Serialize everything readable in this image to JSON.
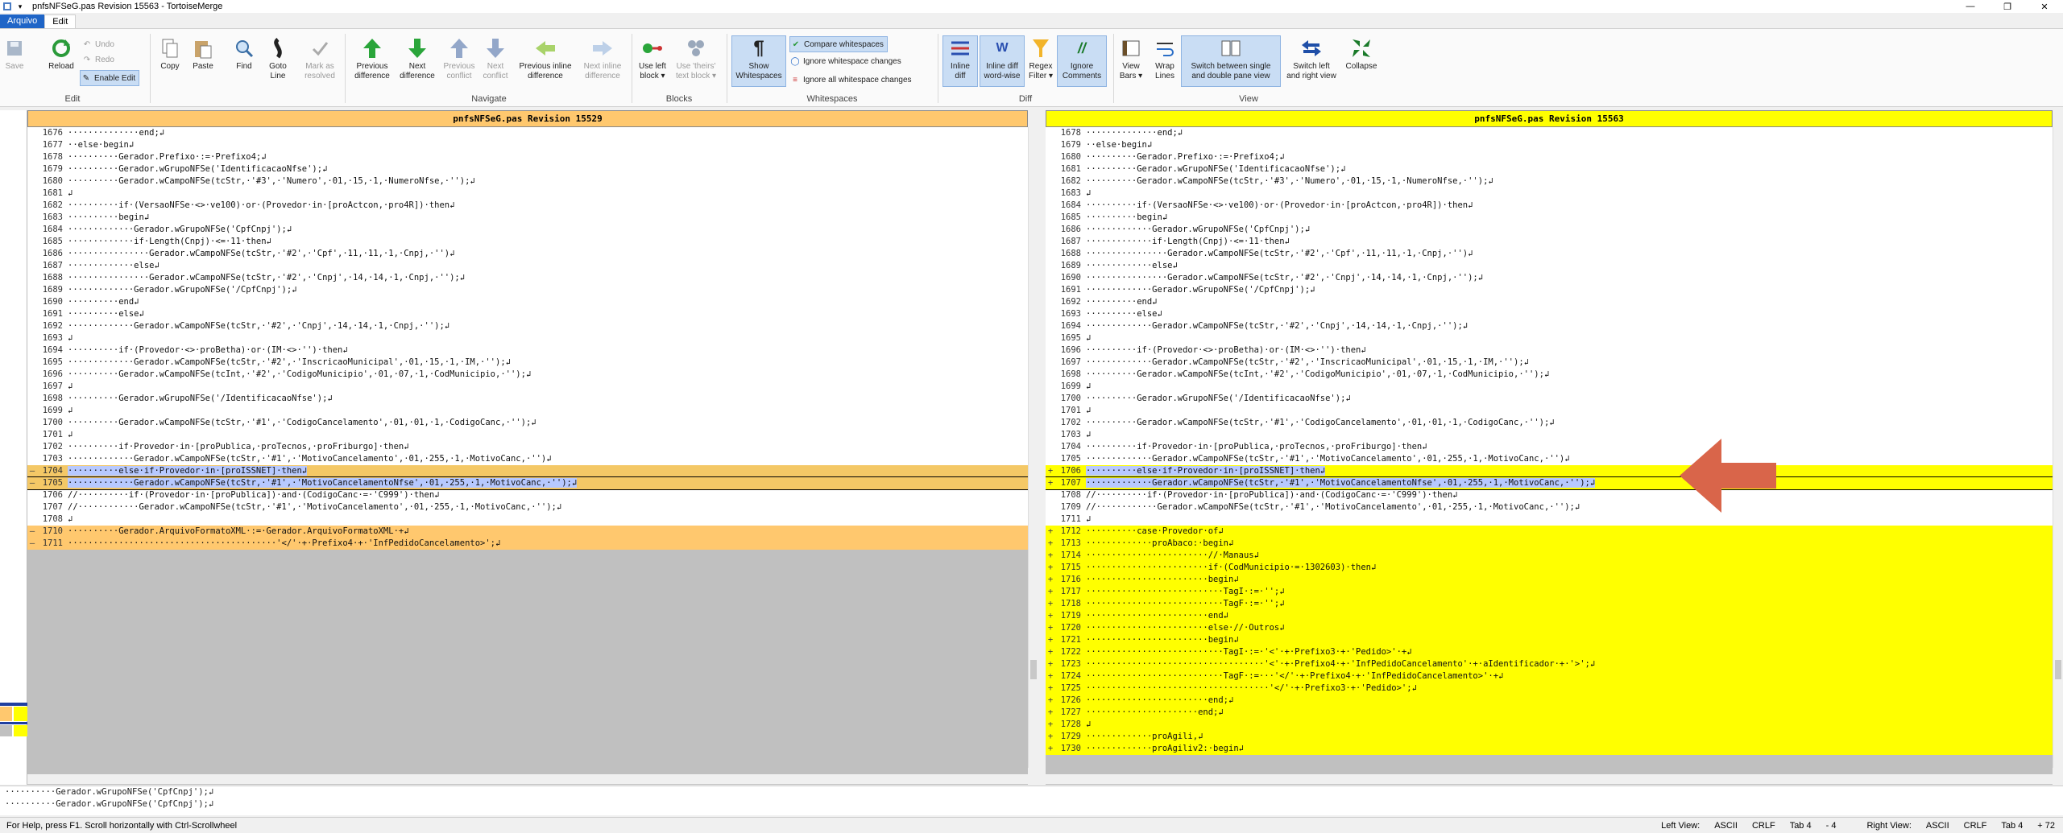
{
  "window": {
    "title": "pnfsNFSeG.pas Revision 15563 - TortoiseMerge"
  },
  "tabs": {
    "file": "Arquivo",
    "edit": "Edit"
  },
  "ribbon": {
    "save": "Save",
    "reload": "Reload",
    "undo": "Undo",
    "redo": "Redo",
    "enable_edit": "Enable Edit",
    "copy": "Copy",
    "paste": "Paste",
    "find": "Find",
    "goto": "Goto\nLine",
    "mark_resolved": "Mark as\nresolved",
    "prev_diff": "Previous\ndifference",
    "next_diff": "Next\ndifference",
    "prev_conflict": "Previous\nconflict",
    "next_conflict": "Next\nconflict",
    "prev_inline": "Previous inline\ndifference",
    "next_inline": "Next inline\ndifference",
    "use_left": "Use left\nblock ▾",
    "use_theirs": "Use 'theirs'\ntext block ▾",
    "show_ws": "Show\nWhitespaces",
    "compare_ws": "Compare whitespaces",
    "ignore_ws_changes": "Ignore whitespace changes",
    "ignore_all_ws": "Ignore all whitespace changes",
    "inline_diff": "Inline\ndiff",
    "inline_diff_word": "Inline diff\nword-wise",
    "regex_filter": "Regex\nFilter ▾",
    "ignore_comments": "Ignore\nComments",
    "view_bars": "View\nBars ▾",
    "wrap_lines": "Wrap\nLines",
    "switch_single_double": "Switch between single\nand double pane view",
    "switch_lr": "Switch left\nand right view",
    "collapse": "Collapse",
    "groups": {
      "edit": "Edit",
      "navigate": "Navigate",
      "blocks": "Blocks",
      "whitespaces": "Whitespaces",
      "diff": "Diff",
      "view": "View"
    }
  },
  "left": {
    "header": "pnfsNFSeG.pas Revision 15529",
    "lines": [
      {
        "m": "",
        "n": "1676",
        "t": "··············end;↲",
        "c": "nrm"
      },
      {
        "m": "",
        "n": "1677",
        "t": "··else·begin↲",
        "c": "nrm"
      },
      {
        "m": "",
        "n": "1678",
        "t": "··········Gerador.Prefixo·:=·Prefixo4;↲",
        "c": "nrm"
      },
      {
        "m": "",
        "n": "1679",
        "t": "··········Gerador.wGrupoNFSe('IdentificacaoNfse');↲",
        "c": "nrm"
      },
      {
        "m": "",
        "n": "1680",
        "t": "··········Gerador.wCampoNFSe(tcStr,·'#3',·'Numero',·01,·15,·1,·NumeroNfse,·'');↲",
        "c": "nrm"
      },
      {
        "m": "",
        "n": "1681",
        "t": "↲",
        "c": "nrm"
      },
      {
        "m": "",
        "n": "1682",
        "t": "··········if·(VersaoNFSe·<>·ve100)·or·(Provedor·in·[proActcon,·pro4R])·then↲",
        "c": "nrm"
      },
      {
        "m": "",
        "n": "1683",
        "t": "··········begin↲",
        "c": "nrm"
      },
      {
        "m": "",
        "n": "1684",
        "t": "·············Gerador.wGrupoNFSe('CpfCnpj');↲",
        "c": "nrm"
      },
      {
        "m": "",
        "n": "1685",
        "t": "·············if·Length(Cnpj)·<=·11·then↲",
        "c": "nrm"
      },
      {
        "m": "",
        "n": "1686",
        "t": "················Gerador.wCampoNFSe(tcStr,·'#2',·'Cpf',·11,·11,·1,·Cnpj,·'')↲",
        "c": "nrm"
      },
      {
        "m": "",
        "n": "1687",
        "t": "·············else↲",
        "c": "nrm"
      },
      {
        "m": "",
        "n": "1688",
        "t": "················Gerador.wCampoNFSe(tcStr,·'#2',·'Cnpj',·14,·14,·1,·Cnpj,·'');↲",
        "c": "nrm"
      },
      {
        "m": "",
        "n": "1689",
        "t": "·············Gerador.wGrupoNFSe('/CpfCnpj');↲",
        "c": "nrm"
      },
      {
        "m": "",
        "n": "1690",
        "t": "··········end↲",
        "c": "nrm"
      },
      {
        "m": "",
        "n": "1691",
        "t": "··········else↲",
        "c": "nrm"
      },
      {
        "m": "",
        "n": "1692",
        "t": "·············Gerador.wCampoNFSe(tcStr,·'#2',·'Cnpj',·14,·14,·1,·Cnpj,·'');↲",
        "c": "nrm"
      },
      {
        "m": "",
        "n": "1693",
        "t": "↲",
        "c": "nrm"
      },
      {
        "m": "",
        "n": "1694",
        "t": "··········if·(Provedor·<>·proBetha)·or·(IM·<>·'')·then↲",
        "c": "nrm"
      },
      {
        "m": "",
        "n": "1695",
        "t": "·············Gerador.wCampoNFSe(tcStr,·'#2',·'InscricaoMunicipal',·01,·15,·1,·IM,·'');↲",
        "c": "nrm"
      },
      {
        "m": "",
        "n": "1696",
        "t": "··········Gerador.wCampoNFSe(tcInt,·'#2',·'CodigoMunicipio',·01,·07,·1,·CodMunicipio,·'');↲",
        "c": "nrm"
      },
      {
        "m": "",
        "n": "1697",
        "t": "↲",
        "c": "nrm"
      },
      {
        "m": "",
        "n": "1698",
        "t": "··········Gerador.wGrupoNFSe('/IdentificacaoNfse');↲",
        "c": "nrm"
      },
      {
        "m": "",
        "n": "1699",
        "t": "↲",
        "c": "nrm"
      },
      {
        "m": "",
        "n": "1700",
        "t": "··········Gerador.wCampoNFSe(tcStr,·'#1',·'CodigoCancelamento',·01,·01,·1,·CodigoCanc,·'');↲",
        "c": "nrm"
      },
      {
        "m": "",
        "n": "1701",
        "t": "↲",
        "c": "nrm"
      },
      {
        "m": "",
        "n": "1702",
        "t": "··········if·Provedor·in·[proPublica,·proTecnos,·proFriburgo]·then↲",
        "c": "nrm"
      },
      {
        "m": "",
        "n": "1703",
        "t": "·············Gerador.wCampoNFSe(tcStr,·'#1',·'MotivoCancelamento',·01,·255,·1,·MotivoCanc,·'')↲",
        "c": "nrm"
      },
      {
        "m": "—",
        "n": "1704",
        "t": "··········else·if·Provedor·in·[proISSNET]·then↲",
        "c": "modl",
        "sel": true
      },
      {
        "m": "—",
        "n": "1705",
        "t": "·············Gerador.wCampoNFSe(tcStr,·'#1',·'MotivoCancelamentoNfse',·01,·255,·1,·MotivoCanc,·'');↲",
        "c": "modl",
        "sel": true,
        "box": true
      },
      {
        "m": "",
        "n": "1706",
        "t": "//··········if·(Provedor·in·[proPublica])·and·(CodigoCanc·=·'C999')·then↲",
        "c": "nrm"
      },
      {
        "m": "",
        "n": "1707",
        "t": "//············Gerador.wCampoNFSe(tcStr,·'#1',·'MotivoCancelamento',·01,·255,·1,·MotivoCanc,·'');↲",
        "c": "nrm"
      },
      {
        "m": "",
        "n": "1708",
        "t": "↲",
        "c": "nrm"
      },
      {
        "m": "—",
        "n": "1710",
        "t": "··········Gerador.ArquivoFormatoXML·:=·Gerador.ArquivoFormatoXML·+↲",
        "c": "rem"
      },
      {
        "m": "—",
        "n": "1711",
        "t": "·········································'</'·+·Prefixo4·+·'InfPedidoCancelamento>';↲",
        "c": "rem"
      }
    ]
  },
  "right": {
    "header": "pnfsNFSeG.pas Revision 15563",
    "lines": [
      {
        "m": "",
        "n": "1678",
        "t": "··············end;↲",
        "c": "nrm"
      },
      {
        "m": "",
        "n": "1679",
        "t": "··else·begin↲",
        "c": "nrm"
      },
      {
        "m": "",
        "n": "1680",
        "t": "··········Gerador.Prefixo·:=·Prefixo4;↲",
        "c": "nrm"
      },
      {
        "m": "",
        "n": "1681",
        "t": "··········Gerador.wGrupoNFSe('IdentificacaoNfse');↲",
        "c": "nrm"
      },
      {
        "m": "",
        "n": "1682",
        "t": "··········Gerador.wCampoNFSe(tcStr,·'#3',·'Numero',·01,·15,·1,·NumeroNfse,·'');↲",
        "c": "nrm"
      },
      {
        "m": "",
        "n": "1683",
        "t": "↲",
        "c": "nrm"
      },
      {
        "m": "",
        "n": "1684",
        "t": "··········if·(VersaoNFSe·<>·ve100)·or·(Provedor·in·[proActcon,·pro4R])·then↲",
        "c": "nrm"
      },
      {
        "m": "",
        "n": "1685",
        "t": "··········begin↲",
        "c": "nrm"
      },
      {
        "m": "",
        "n": "1686",
        "t": "·············Gerador.wGrupoNFSe('CpfCnpj');↲",
        "c": "nrm"
      },
      {
        "m": "",
        "n": "1687",
        "t": "·············if·Length(Cnpj)·<=·11·then↲",
        "c": "nrm"
      },
      {
        "m": "",
        "n": "1688",
        "t": "················Gerador.wCampoNFSe(tcStr,·'#2',·'Cpf',·11,·11,·1,·Cnpj,·'')↲",
        "c": "nrm"
      },
      {
        "m": "",
        "n": "1689",
        "t": "·············else↲",
        "c": "nrm"
      },
      {
        "m": "",
        "n": "1690",
        "t": "················Gerador.wCampoNFSe(tcStr,·'#2',·'Cnpj',·14,·14,·1,·Cnpj,·'');↲",
        "c": "nrm"
      },
      {
        "m": "",
        "n": "1691",
        "t": "·············Gerador.wGrupoNFSe('/CpfCnpj');↲",
        "c": "nrm"
      },
      {
        "m": "",
        "n": "1692",
        "t": "··········end↲",
        "c": "nrm"
      },
      {
        "m": "",
        "n": "1693",
        "t": "··········else↲",
        "c": "nrm"
      },
      {
        "m": "",
        "n": "1694",
        "t": "·············Gerador.wCampoNFSe(tcStr,·'#2',·'Cnpj',·14,·14,·1,·Cnpj,·'');↲",
        "c": "nrm"
      },
      {
        "m": "",
        "n": "1695",
        "t": "↲",
        "c": "nrm"
      },
      {
        "m": "",
        "n": "1696",
        "t": "··········if·(Provedor·<>·proBetha)·or·(IM·<>·'')·then↲",
        "c": "nrm"
      },
      {
        "m": "",
        "n": "1697",
        "t": "·············Gerador.wCampoNFSe(tcStr,·'#2',·'InscricaoMunicipal',·01,·15,·1,·IM,·'');↲",
        "c": "nrm"
      },
      {
        "m": "",
        "n": "1698",
        "t": "··········Gerador.wCampoNFSe(tcInt,·'#2',·'CodigoMunicipio',·01,·07,·1,·CodMunicipio,·'');↲",
        "c": "nrm"
      },
      {
        "m": "",
        "n": "1699",
        "t": "↲",
        "c": "nrm"
      },
      {
        "m": "",
        "n": "1700",
        "t": "··········Gerador.wGrupoNFSe('/IdentificacaoNfse');↲",
        "c": "nrm"
      },
      {
        "m": "",
        "n": "1701",
        "t": "↲",
        "c": "nrm"
      },
      {
        "m": "",
        "n": "1702",
        "t": "··········Gerador.wCampoNFSe(tcStr,·'#1',·'CodigoCancelamento',·01,·01,·1,·CodigoCanc,·'');↲",
        "c": "nrm"
      },
      {
        "m": "",
        "n": "1703",
        "t": "↲",
        "c": "nrm"
      },
      {
        "m": "",
        "n": "1704",
        "t": "··········if·Provedor·in·[proPublica,·proTecnos,·proFriburgo]·then↲",
        "c": "nrm"
      },
      {
        "m": "",
        "n": "1705",
        "t": "·············Gerador.wCampoNFSe(tcStr,·'#1',·'MotivoCancelamento',·01,·255,·1,·MotivoCanc,·'')↲",
        "c": "nrm"
      },
      {
        "m": "+",
        "n": "1706",
        "t": "··········else·if·Provedor·in·[proISSNET]·then↲",
        "c": "mod",
        "sel": true
      },
      {
        "m": "+",
        "n": "1707",
        "t": "·············Gerador.wCampoNFSe(tcStr,·'#1',·'MotivoCancelamentoNfse',·01,·255,·1,·MotivoCanc,·'');↲",
        "c": "mod",
        "sel": true,
        "box": true
      },
      {
        "m": "",
        "n": "1708",
        "t": "//··········if·(Provedor·in·[proPublica])·and·(CodigoCanc·=·'C999')·then↲",
        "c": "nrm"
      },
      {
        "m": "",
        "n": "1709",
        "t": "//············Gerador.wCampoNFSe(tcStr,·'#1',·'MotivoCancelamento',·01,·255,·1,·MotivoCanc,·'');↲",
        "c": "nrm"
      },
      {
        "m": "",
        "n": "1711",
        "t": "↲",
        "c": "nrm"
      },
      {
        "m": "+",
        "n": "1712",
        "t": "··········case·Provedor·of↲",
        "c": "add"
      },
      {
        "m": "+",
        "n": "1713",
        "t": "·············proAbaco:·begin↲",
        "c": "add"
      },
      {
        "m": "+",
        "n": "1714",
        "t": "························//·Manaus↲",
        "c": "add"
      },
      {
        "m": "+",
        "n": "1715",
        "t": "························if·(CodMunicipio·=·1302603)·then↲",
        "c": "add"
      },
      {
        "m": "+",
        "n": "1716",
        "t": "························begin↲",
        "c": "add"
      },
      {
        "m": "+",
        "n": "1717",
        "t": "···························TagI·:=·'';↲",
        "c": "add"
      },
      {
        "m": "+",
        "n": "1718",
        "t": "···························TagF·:=·'';↲",
        "c": "add"
      },
      {
        "m": "+",
        "n": "1719",
        "t": "························end↲",
        "c": "add"
      },
      {
        "m": "+",
        "n": "1720",
        "t": "························else·//·Outros↲",
        "c": "add"
      },
      {
        "m": "+",
        "n": "1721",
        "t": "························begin↲",
        "c": "add"
      },
      {
        "m": "+",
        "n": "1722",
        "t": "···························TagI·:=·'<'·+·Prefixo3·+·'Pedido>'·+↲",
        "c": "add"
      },
      {
        "m": "+",
        "n": "1723",
        "t": "···································'<'·+·Prefixo4·+·'InfPedidoCancelamento'·+·aIdentificador·+·'>';↲",
        "c": "add"
      },
      {
        "m": "+",
        "n": "1724",
        "t": "···························TagF·:=···'</'·+·Prefixo4·+·'InfPedidoCancelamento>'·+↲",
        "c": "add"
      },
      {
        "m": "+",
        "n": "1725",
        "t": "····································'</'·+·Prefixo3·+·'Pedido>';↲",
        "c": "add"
      },
      {
        "m": "+",
        "n": "1726",
        "t": "························end;↲",
        "c": "add"
      },
      {
        "m": "+",
        "n": "1727",
        "t": "······················end;↲",
        "c": "add"
      },
      {
        "m": "+",
        "n": "1728",
        "t": "↲",
        "c": "add"
      },
      {
        "m": "+",
        "n": "1729",
        "t": "·············proAgili,↲",
        "c": "add"
      },
      {
        "m": "+",
        "n": "1730",
        "t": "·············proAgiliv2:·begin↲",
        "c": "add"
      }
    ]
  },
  "bottom": {
    "line1": "··········Gerador.wGrupoNFSe('CpfCnpj');↲",
    "line2": "··········Gerador.wGrupoNFSe('CpfCnpj');↲"
  },
  "status": {
    "help": "For Help, press F1. Scroll horizontally with Ctrl-Scrollwheel",
    "left_view": "Left View:",
    "left_enc": "ASCII",
    "left_eol": "CRLF",
    "left_tab": "Tab 4",
    "left_count": "- 4",
    "right_view": "Right View:",
    "right_enc": "ASCII",
    "right_eol": "CRLF",
    "right_tab": "Tab 4",
    "right_count": "+ 72"
  },
  "colors": {
    "removed": "#ffc86e",
    "added": "#ffff00",
    "empty": "#c0c0c0",
    "selected": "#b7c9ff",
    "arrow": "#d9654a",
    "accent": "#1f65c7"
  }
}
